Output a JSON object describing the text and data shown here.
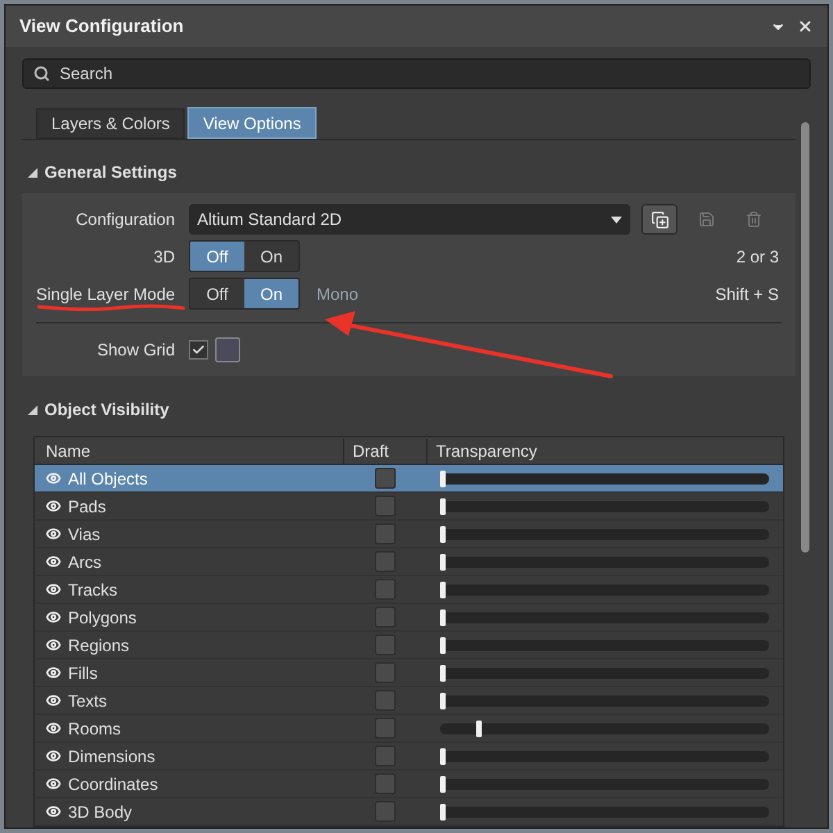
{
  "window": {
    "title": "View Configuration"
  },
  "search": {
    "placeholder": "Search"
  },
  "tabs": [
    {
      "label": "Layers & Colors",
      "selected": false
    },
    {
      "label": "View Options",
      "selected": true
    }
  ],
  "general_settings": {
    "title": "General Settings",
    "expanded": true,
    "configuration": {
      "label": "Configuration",
      "value": "Altium Standard 2D"
    },
    "toggles": [
      {
        "label": "3D",
        "options": [
          {
            "label": "Off",
            "selected": true
          },
          {
            "label": "On",
            "selected": false
          }
        ],
        "shortcut": "2 or 3"
      },
      {
        "label": "Single Layer Mode",
        "options": [
          {
            "label": "Off",
            "selected": false
          },
          {
            "label": "On",
            "selected": true
          }
        ],
        "extra": "Mono",
        "shortcut": "Shift + S"
      }
    ],
    "show_grid": {
      "label": "Show Grid",
      "checked": true
    }
  },
  "object_visibility": {
    "title": "Object Visibility",
    "expanded": true,
    "columns": [
      "Name",
      "Draft",
      "Transparency"
    ],
    "rows": [
      {
        "name": "All Objects",
        "selected": true,
        "draft": false,
        "level": 0
      },
      {
        "name": "Pads",
        "selected": false,
        "draft": false,
        "level": 0
      },
      {
        "name": "Vias",
        "selected": false,
        "draft": false,
        "level": 0
      },
      {
        "name": "Arcs",
        "selected": false,
        "draft": false,
        "level": 0
      },
      {
        "name": "Tracks",
        "selected": false,
        "draft": false,
        "level": 0
      },
      {
        "name": "Polygons",
        "selected": false,
        "draft": false,
        "level": 0
      },
      {
        "name": "Regions",
        "selected": false,
        "draft": false,
        "level": 0
      },
      {
        "name": "Fills",
        "selected": false,
        "draft": false,
        "level": 0
      },
      {
        "name": "Texts",
        "selected": false,
        "draft": false,
        "level": 0
      },
      {
        "name": "Rooms",
        "selected": false,
        "draft": false,
        "level": 0.11
      },
      {
        "name": "Dimensions",
        "selected": false,
        "draft": false,
        "level": 0
      },
      {
        "name": "Coordinates",
        "selected": false,
        "draft": false,
        "level": 0
      },
      {
        "name": "3D Body",
        "selected": false,
        "draft": false,
        "level": 0
      }
    ]
  }
}
